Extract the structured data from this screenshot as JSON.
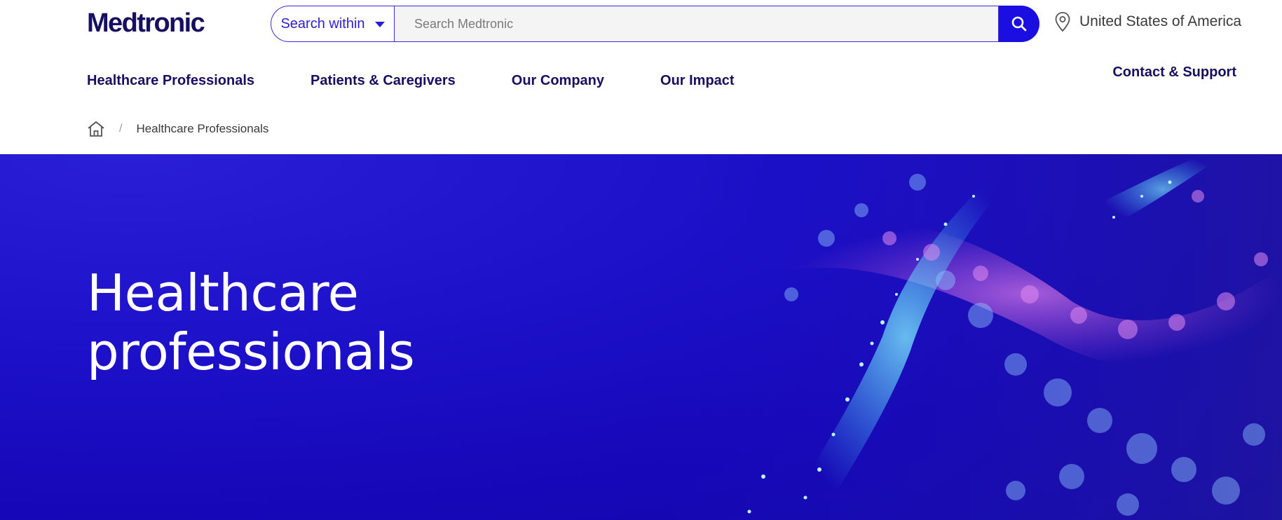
{
  "brand": {
    "logo_text": "Medtronic"
  },
  "search": {
    "scope_label": "Search within",
    "placeholder": "Search Medtronic",
    "value": ""
  },
  "locale": {
    "country": "United States of America"
  },
  "nav": {
    "items": [
      {
        "label": "Healthcare Professionals"
      },
      {
        "label": "Patients & Caregivers"
      },
      {
        "label": "Our Company"
      },
      {
        "label": "Our Impact"
      }
    ],
    "contact_label": "Contact & Support"
  },
  "breadcrumb": {
    "separator": "/",
    "current": "Healthcare Professionals"
  },
  "hero": {
    "title_line1": "Healthcare",
    "title_line2": "professionals"
  },
  "colors": {
    "brand_navy": "#170f5f",
    "accent_blue": "#1a0fe0",
    "hero_blue": "#1c10c8",
    "particle_cyan": "#3fd6ff",
    "particle_pink": "#e05fd8"
  },
  "icons": {
    "search": "search-icon",
    "location": "location-pin-icon",
    "home": "home-icon",
    "dropdown": "chevron-down-icon"
  }
}
